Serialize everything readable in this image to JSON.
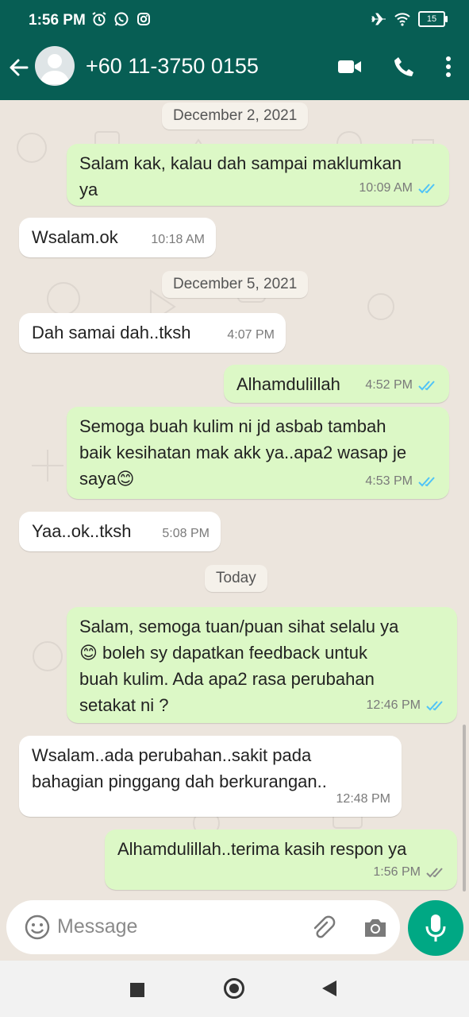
{
  "status_bar": {
    "time": "1:56 PM",
    "battery": "15",
    "left_icons": [
      "alarm-icon",
      "whatsapp-icon",
      "instagram-icon"
    ],
    "right_icons": [
      "airplane-icon",
      "wifi-icon",
      "battery-icon"
    ]
  },
  "header": {
    "contact": "+60 11-3750 0155",
    "icons": [
      "back-arrow-icon",
      "avatar",
      "video-call-icon",
      "phone-icon",
      "more-vert-icon"
    ]
  },
  "chat": {
    "date_chips": [
      "December 2, 2021",
      "December 5, 2021",
      "Today"
    ],
    "messages": [
      {
        "dir": "out",
        "lines": [
          "Salam kak, kalau dah sampai maklumkan",
          "ya"
        ],
        "time": "10:09 AM",
        "read": true
      },
      {
        "dir": "in",
        "lines": [
          "Wsalam.ok"
        ],
        "time": "10:18 AM"
      },
      {
        "dir": "in",
        "lines": [
          "Dah samai dah..tksh"
        ],
        "time": "4:07 PM"
      },
      {
        "dir": "out",
        "lines": [
          "Alhamdulillah"
        ],
        "time": "4:52 PM",
        "read": true
      },
      {
        "dir": "out",
        "lines": [
          "Semoga buah kulim ni jd asbab tambah",
          "baik kesihatan mak akk ya..apa2 wasap je",
          "saya😊"
        ],
        "time": "4:53 PM",
        "read": true
      },
      {
        "dir": "in",
        "lines": [
          "Yaa..ok..tksh"
        ],
        "time": "5:08 PM"
      },
      {
        "dir": "out",
        "lines": [
          "Salam, semoga tuan/puan sihat selalu ya",
          "😊 boleh sy dapatkan feedback untuk",
          "buah kulim. Ada apa2 rasa perubahan",
          "setakat ni ?"
        ],
        "time": "12:46 PM",
        "read": true
      },
      {
        "dir": "in",
        "lines": [
          "Wsalam..ada perubahan..sakit pada",
          "bahagian pinggang dah berkurangan.."
        ],
        "time": "12:48 PM"
      },
      {
        "dir": "out",
        "lines": [
          "Alhamdulillah..terima kasih respon ya"
        ],
        "time": "1:56 PM",
        "read": false
      }
    ]
  },
  "input": {
    "placeholder": "Message",
    "icons": [
      "emoji-icon",
      "attach-icon",
      "camera-icon",
      "mic-icon"
    ]
  },
  "colors": {
    "header": "#075E54",
    "outgoing_bubble": "#DCF8C6",
    "incoming_bubble": "#FFFFFF",
    "background": "#ECE5DD",
    "read_tick": "#4FC3F7",
    "mic_button": "#00A884"
  }
}
